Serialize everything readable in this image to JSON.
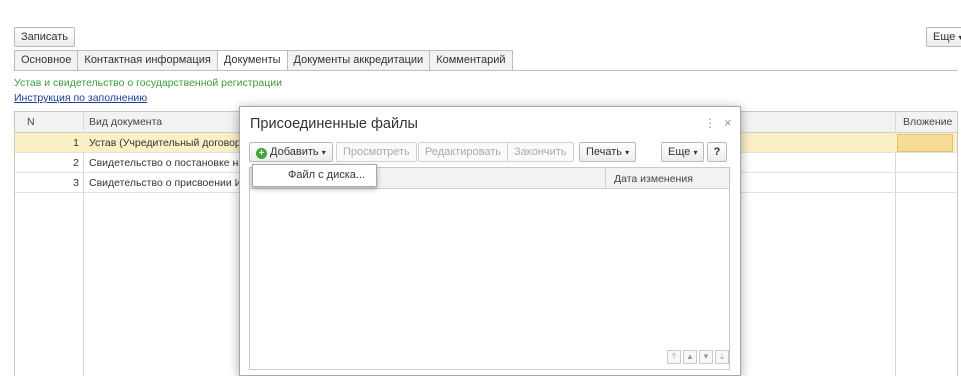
{
  "toolbar": {
    "write_label": "Записать",
    "more_label": "Еще"
  },
  "tabs": [
    {
      "label": "Основное"
    },
    {
      "label": "Контактная информация"
    },
    {
      "label": "Документы"
    },
    {
      "label": "Документы аккредитации"
    },
    {
      "label": "Комментарий"
    }
  ],
  "active_tab": "Документы",
  "section": {
    "hint": "Устав и свидетельство о государственной регистрации",
    "instruction_link": "Инструкция по заполнению"
  },
  "grid": {
    "columns": {
      "n": "N",
      "doc_type": "Вид документа",
      "attachment": "Вложение"
    },
    "rows": [
      {
        "n": "1",
        "doc_type": "Устав (Учредительный договор), пс"
      },
      {
        "n": "2",
        "doc_type": "Свидетельство о постановке на учё"
      },
      {
        "n": "3",
        "doc_type": "Свидетельство о присвоении ИНН/"
      }
    ]
  },
  "dialog": {
    "title": "Присоединенные файлы",
    "more_icon": "⋮",
    "close_icon": "×",
    "buttons": {
      "add": "Добавить",
      "view": "Просмотреть",
      "edit": "Редактировать",
      "finish": "Закончить",
      "print": "Печать",
      "more": "Еще",
      "help": "?"
    },
    "columns": {
      "date": "Дата изменения"
    },
    "add_menu": [
      {
        "label": "Файл с диска..."
      }
    ]
  },
  "colors": {
    "selected_row": "#fbefc6",
    "attachment_cell": "#f6dc95",
    "add_icon": "#3da63d",
    "hint_text": "#3c9a3c",
    "link": "#1d3f8f"
  }
}
